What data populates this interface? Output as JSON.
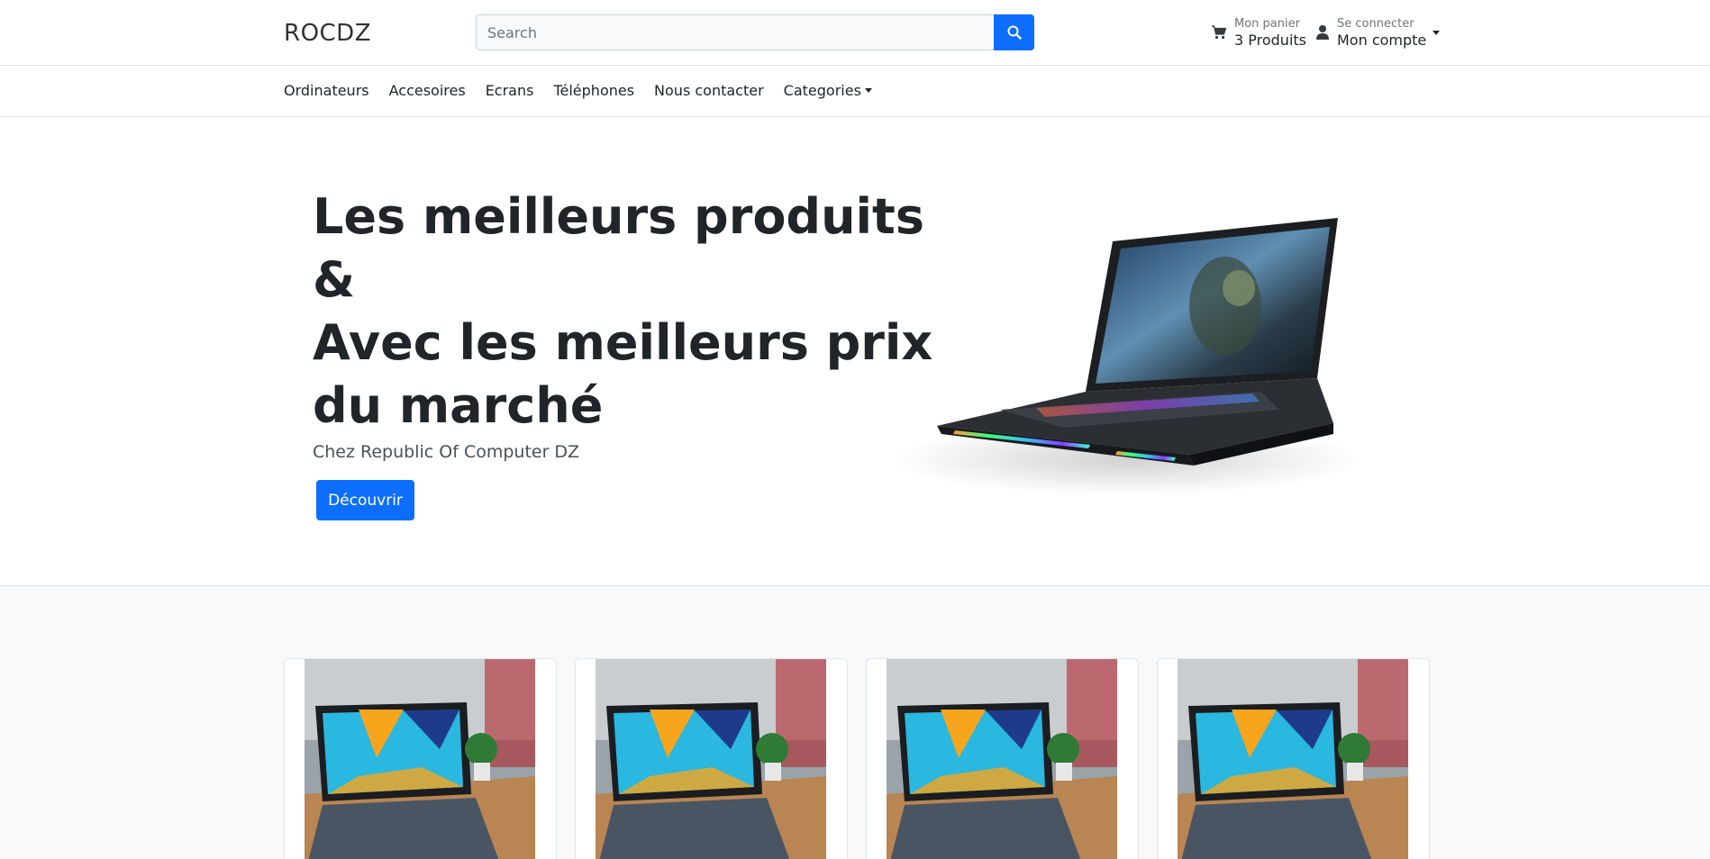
{
  "header": {
    "brand": "ROCDZ",
    "search": {
      "placeholder": "Search",
      "value": ""
    },
    "cart": {
      "label": "Mon panier",
      "count_text": "3 Produits"
    },
    "account": {
      "label": "Se connecter",
      "title": "Mon compte"
    }
  },
  "nav": {
    "items": [
      {
        "label": "Ordinateurs"
      },
      {
        "label": "Accesoires"
      },
      {
        "label": "Ecrans"
      },
      {
        "label": "Téléphones"
      },
      {
        "label": "Nous contacter"
      },
      {
        "label": "Categories"
      }
    ]
  },
  "hero": {
    "title_lines": [
      "Les meilleurs produits",
      "&",
      "Avec les meilleurs prix",
      "du marché"
    ],
    "subtitle": "Chez Republic Of Computer DZ",
    "button": "Découvrir"
  },
  "icons": {
    "search": "search-icon",
    "cart": "cart-icon",
    "user": "user-icon"
  },
  "colors": {
    "primary": "#0d6efd",
    "text": "#212529",
    "muted": "#6c757d",
    "section_bg": "#f8f9fa"
  },
  "products": [
    {
      "image": "laptop-tablet-photo"
    },
    {
      "image": "laptop-tablet-photo"
    },
    {
      "image": "laptop-tablet-photo"
    },
    {
      "image": "laptop-tablet-photo"
    }
  ]
}
